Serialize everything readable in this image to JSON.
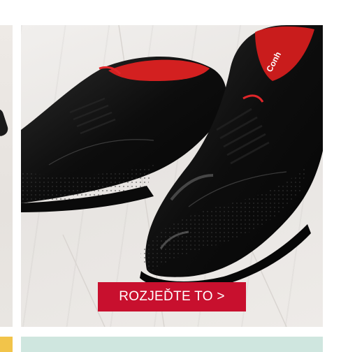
{
  "promo": {
    "cta_label": "ROZJEĎTE TO >",
    "brand_text": "Conh",
    "cta_color": "#c8102e"
  },
  "colors": {
    "left_bottom": "#f2c44a",
    "bottom_card": "#cfe6df"
  }
}
